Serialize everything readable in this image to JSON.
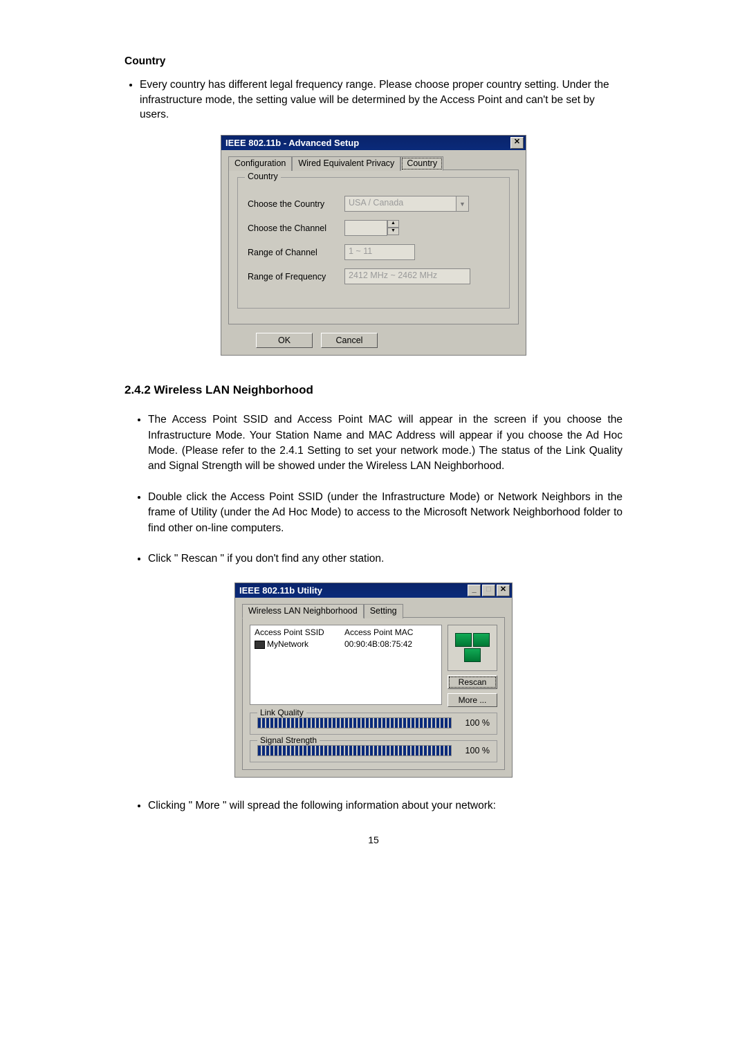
{
  "doc": {
    "country_heading": "Country",
    "country_bullet": "Every country has different legal frequency range. Please choose proper country setting. Under the infrastructure mode, the setting value will be determined by the Access Point and can't be set by users.",
    "section_heading": "2.4.2 Wireless LAN Neighborhood",
    "bullets": [
      "The Access Point SSID and Access Point MAC will appear in the screen if you choose the Infrastructure Mode. Your Station Name and MAC Address will appear if you choose the Ad Hoc Mode. (Please refer to the 2.4.1 Setting to set your network mode.) The status of the Link Quality and Signal Strength will be showed under the Wireless LAN Neighborhood.",
      "Double click the Access Point SSID (under the Infrastructure Mode) or Network Neighbors in the frame of Utility (under the Ad Hoc Mode) to access to the Microsoft Network Neighborhood folder to find other on-line computers.",
      "Click  \" Rescan \"  if you don't find any other station."
    ],
    "bullet_more": "Clicking  \" More \"  will spread the following information about your network:",
    "page_number": "15"
  },
  "dlg1": {
    "title": "IEEE 802.11b - Advanced Setup",
    "close_glyph": "✕",
    "tabs": {
      "t1": "Configuration",
      "t2": "Wired Equivalent Privacy",
      "t3": "Country"
    },
    "group_legend": "Country",
    "f_country_label": "Choose the Country",
    "f_country_value": "USA / Canada",
    "f_channel_label": "Choose the Channel",
    "f_channel_value": "",
    "f_range_ch_label": "Range of Channel",
    "f_range_ch_value": "1 ~ 11",
    "f_range_fq_label": "Range of Frequency",
    "f_range_fq_value": "2412 MHz ~ 2462 MHz",
    "btn_ok": "OK",
    "btn_cancel": "Cancel"
  },
  "dlg2": {
    "title": "IEEE 802.11b Utility",
    "min_glyph": "_",
    "max_glyph": "□",
    "close_glyph": "✕",
    "tabs": {
      "t1": "Wireless LAN Neighborhood",
      "t2": "Setting"
    },
    "col_ssid": "Access Point SSID",
    "col_mac": "Access Point MAC",
    "row_ssid": "MyNetwork",
    "row_mac": "00:90:4B:08:75:42",
    "btn_rescan": "Rescan",
    "btn_more": "More ...",
    "link_quality_label": "Link Quality",
    "link_quality_value": "100 %",
    "signal_strength_label": "Signal Strength",
    "signal_strength_value": "100 %"
  }
}
